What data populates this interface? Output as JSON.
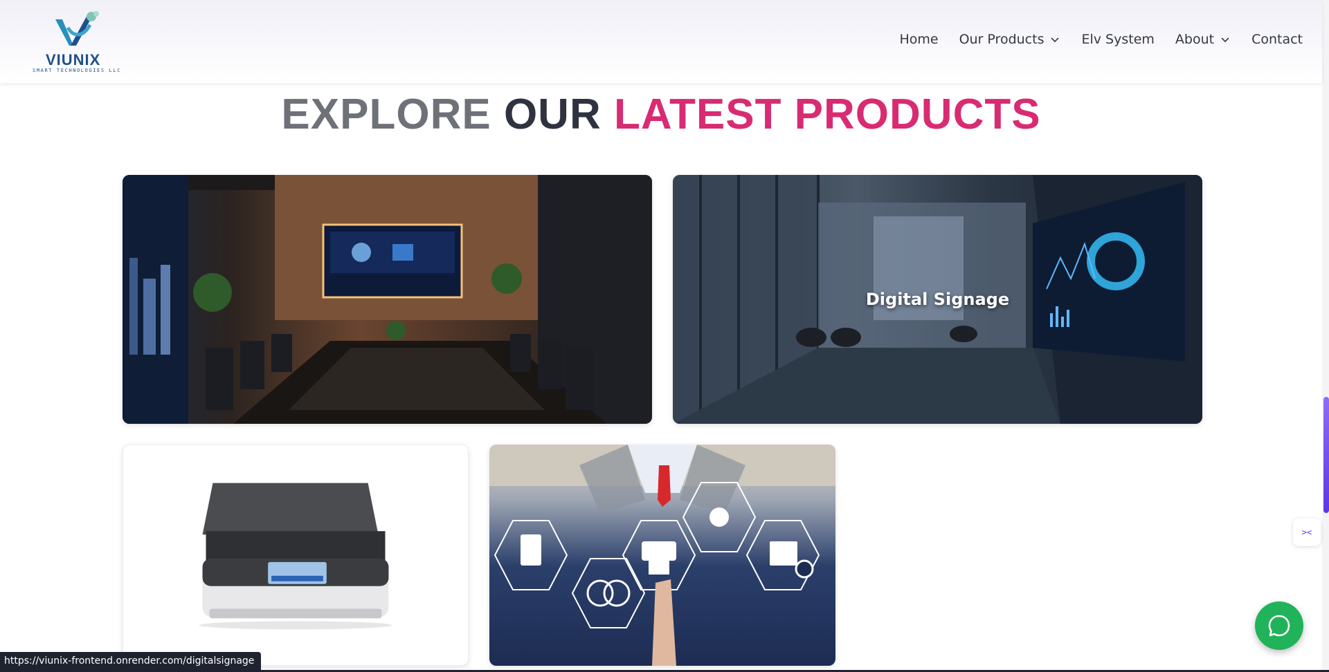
{
  "brand": {
    "name": "VIUNIX",
    "tagline": "SMART TECHNOLOGIES LLC",
    "colors": {
      "primary": "#1f4f8f",
      "accent": "#d82b72",
      "chat": "#20b35a"
    }
  },
  "nav": {
    "items": [
      {
        "label": "Home",
        "has_dropdown": false
      },
      {
        "label": "Our Products",
        "has_dropdown": true
      },
      {
        "label": "Elv System",
        "has_dropdown": false
      },
      {
        "label": "About",
        "has_dropdown": true
      },
      {
        "label": "Contact",
        "has_dropdown": false
      }
    ]
  },
  "section": {
    "title_part1": "EXPLORE",
    "title_part2": "OUR",
    "title_part3": "LATEST PRODUCTS"
  },
  "cards": [
    {
      "image": "conference-room-photo",
      "label": ""
    },
    {
      "image": "office-dashboard-photo",
      "label": "Digital Signage"
    },
    {
      "image": "document-scanner-photo",
      "label": ""
    },
    {
      "image": "document-management-icons-photo",
      "label": ""
    }
  ],
  "status_bar": {
    "url": "https://viunix-frontend.onrender.com/digitalsignage"
  },
  "icons": {
    "chat": "whatsapp-chat-icon",
    "dropdown": "chevron-down-icon",
    "side_widget": "code-icon"
  }
}
